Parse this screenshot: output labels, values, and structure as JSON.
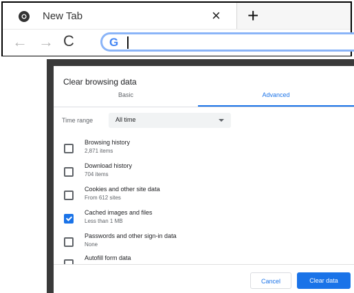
{
  "browser": {
    "tab_title": "New Tab",
    "tab_close": "×",
    "new_tab": "+",
    "back": "←",
    "forward": "→",
    "reload": "C",
    "omnibox_logo": "G",
    "omnibox_value": ""
  },
  "dialog": {
    "title": "Clear browsing data",
    "tabs": [
      {
        "label": "Basic",
        "selected": false
      },
      {
        "label": "Advanced",
        "selected": true
      }
    ],
    "time_range": {
      "label": "Time range",
      "value": "All time"
    },
    "options": [
      {
        "title": "Browsing history",
        "subtitle": "2,871 items",
        "checked": false
      },
      {
        "title": "Download history",
        "subtitle": "704 items",
        "checked": false
      },
      {
        "title": "Cookies and other site data",
        "subtitle": "From 612 sites",
        "checked": false
      },
      {
        "title": "Cached images and files",
        "subtitle": "Less than 1 MB",
        "checked": true
      },
      {
        "title": "Passwords and other sign-in data",
        "subtitle": "None",
        "checked": false
      },
      {
        "title": "Autofill form data",
        "subtitle": "",
        "checked": false
      }
    ],
    "buttons": {
      "cancel": "Cancel",
      "clear": "Clear data"
    }
  },
  "colors": {
    "accent": "#1a73e8",
    "overlay": "#3a3a3a"
  }
}
